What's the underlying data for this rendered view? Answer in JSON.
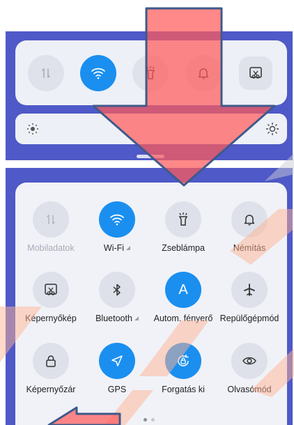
{
  "colors": {
    "panel_blue": "#4f59c7",
    "active_blue": "#1a8ff0",
    "arrow_red": "#ff5a5a",
    "arrow_border": "#3e5a8c"
  },
  "collapsed": {
    "icons": [
      "mobile-data-icon",
      "wifi-icon",
      "flashlight-icon",
      "bell-icon",
      "screenshot-icon"
    ],
    "slider_icons": [
      "brightness-low-icon",
      "brightness-high-icon"
    ]
  },
  "tiles": {
    "mobile_data": "Mobiladatok",
    "wifi": "Wi-Fi",
    "flashlight": "Zseblámpa",
    "mute": "Némítás",
    "screenshot": "Képernyőkép",
    "bluetooth": "Bluetooth",
    "auto_brightness": "Autom. fényerő",
    "auto_brightness_letter": "A",
    "airplane": "Repülőgépmód",
    "screen_lock": "Képernyőzár",
    "gps": "GPS",
    "rotation": "Forgatás ki",
    "reading": "Olvasómód"
  },
  "pager": {
    "pages": 2,
    "current": 1
  }
}
